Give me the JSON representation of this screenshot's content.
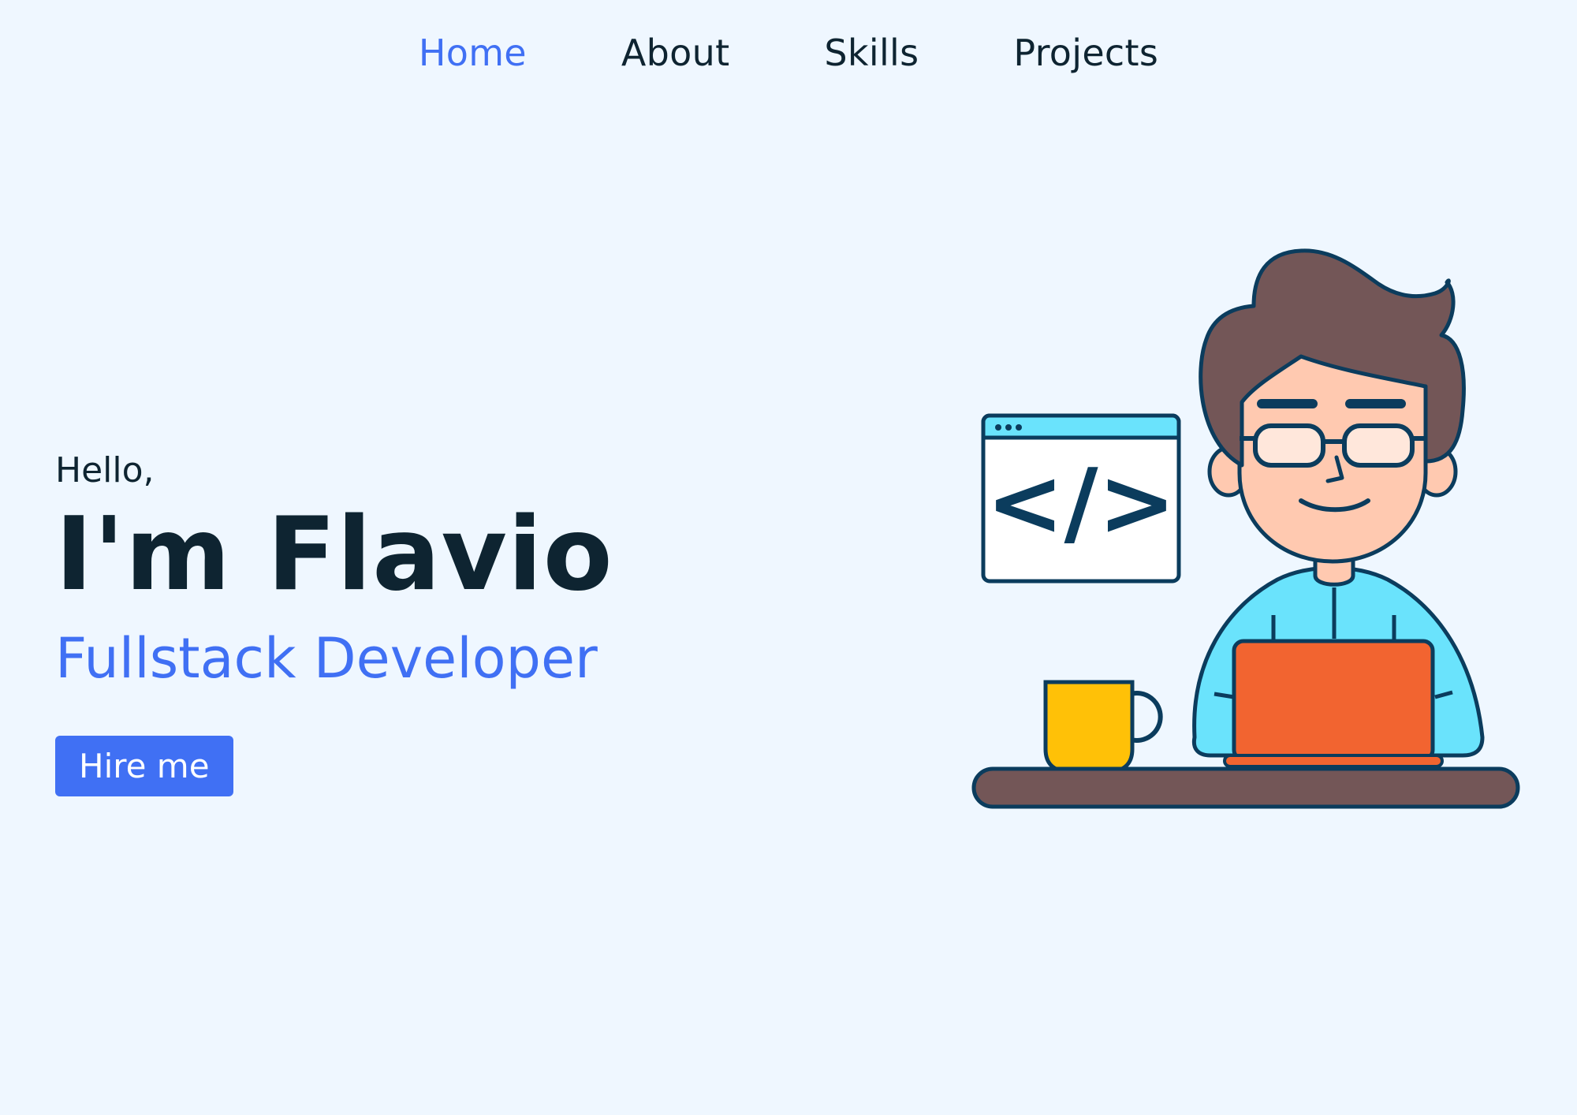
{
  "nav": {
    "items": [
      {
        "label": "Home",
        "active": true
      },
      {
        "label": "About",
        "active": false
      },
      {
        "label": "Skills",
        "active": false
      },
      {
        "label": "Projects",
        "active": false
      }
    ]
  },
  "hero": {
    "greeting": "Hello,",
    "name": "I'm Flavio",
    "role": "Fullstack Developer",
    "cta_label": "Hire me"
  },
  "illustration": {
    "code_window_text": "</>"
  },
  "colors": {
    "background": "#eff7ff",
    "accent": "#4070f4",
    "text": "#0e2431",
    "outline": "#0b3c5d",
    "shirt": "#6ae3fc",
    "laptop": "#f26430",
    "mug": "#ffc107",
    "hair": "#735657",
    "skin": "#ffc9b0"
  }
}
